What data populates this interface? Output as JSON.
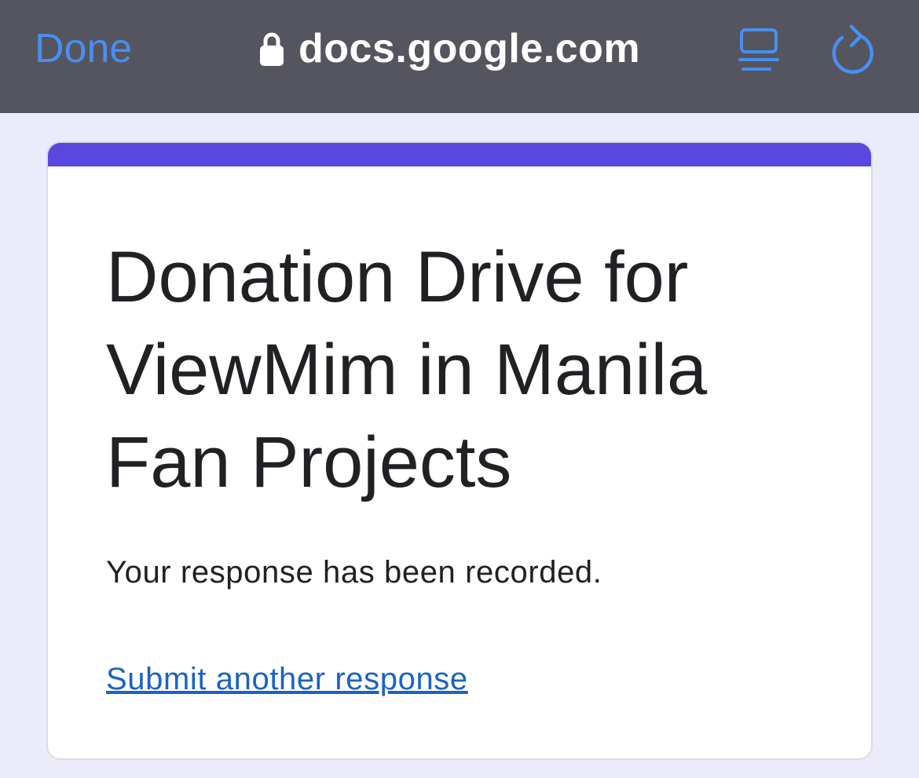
{
  "browser": {
    "done_label": "Done",
    "url": "docs.google.com",
    "icons": {
      "lock": "lock-icon",
      "reader": "reader-view-icon",
      "reload": "reload-icon"
    },
    "colors": {
      "toolbar_bg": "#54555e",
      "accent_blue": "#4a8ef0",
      "url_text": "#ffffff"
    }
  },
  "form": {
    "title": "Donation Drive for ViewMim in Manila Fan Projects",
    "confirmation": "Your response has been recorded.",
    "submit_another": "Submit another response",
    "colors": {
      "page_bg": "#ecebfa",
      "header_accent": "#5a47e0",
      "link": "#1a62c8"
    }
  }
}
